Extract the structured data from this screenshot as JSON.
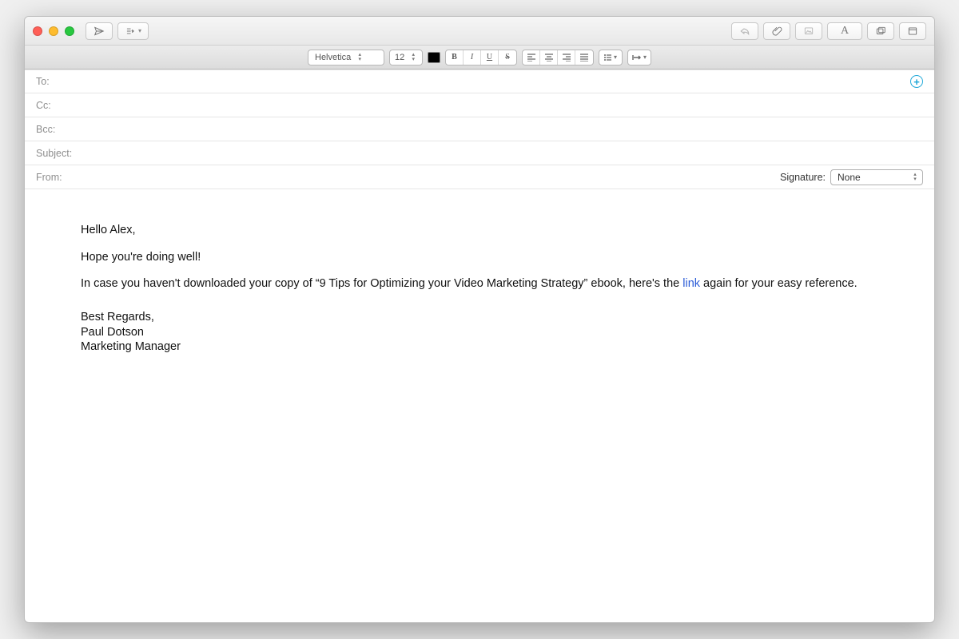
{
  "format": {
    "font": "Helvetica",
    "size": "12",
    "bold": "B",
    "italic": "I",
    "underline": "U",
    "strike": "S"
  },
  "fields": {
    "to": "To:",
    "cc": "Cc:",
    "bcc": "Bcc:",
    "subject": "Subject:",
    "from": "From:",
    "signature_label": "Signature:",
    "signature_value": "None"
  },
  "body": {
    "greeting": "Hello Alex,",
    "line1": "Hope you're doing well!",
    "line2a": "In case you haven't downloaded your copy of “9 Tips for Optimizing your Video Marketing Strategy” ebook, here's the ",
    "link_text": "link",
    "line2b": " again for your easy reference.",
    "closing": "Best Regards,",
    "sender_name": "Paul Dotson",
    "sender_title": "Marketing Manager"
  }
}
